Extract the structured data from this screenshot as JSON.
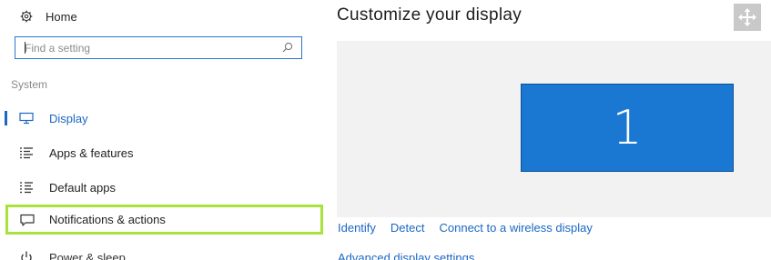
{
  "sidebar": {
    "home_label": "Home",
    "home_icon": "gear-icon",
    "search": {
      "placeholder": "Find a setting",
      "icon": "search-icon"
    },
    "section_title": "System",
    "items": [
      {
        "label": "Display",
        "icon": "monitor-icon",
        "active": true
      },
      {
        "label": "Apps & features",
        "icon": "apps-list-icon"
      },
      {
        "label": "Default apps",
        "icon": "default-apps-icon"
      },
      {
        "label": "Notifications & actions",
        "icon": "notifications-icon",
        "highlighted": true
      },
      {
        "label": "Power & sleep",
        "icon": "power-icon"
      }
    ]
  },
  "main": {
    "title": "Customize your display",
    "move_icon": "move-arrows-icon",
    "monitor_number": "1",
    "links": {
      "identify": "Identify",
      "detect": "Detect",
      "wireless": "Connect to a wireless display"
    },
    "cut_link": "Advanced display settings"
  },
  "colors": {
    "accent": "#1b67c4",
    "monitor": "#1a78d2",
    "highlight": "#a9e23c",
    "preview_bg": "#f2f2f2"
  }
}
